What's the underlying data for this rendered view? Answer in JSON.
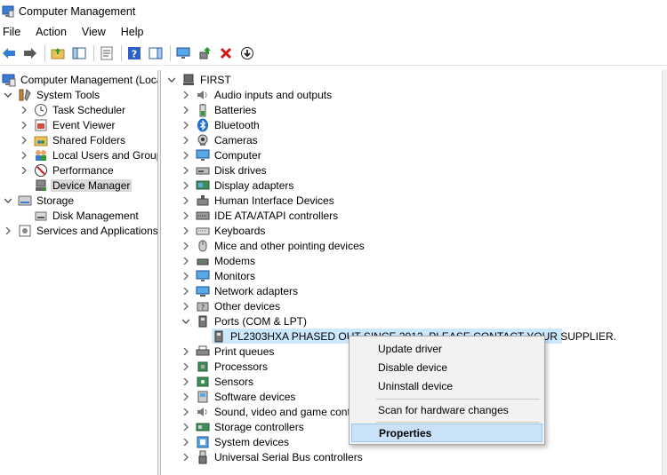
{
  "window": {
    "title": "Computer Management"
  },
  "menu": [
    "File",
    "Action",
    "View",
    "Help"
  ],
  "toolbar": {
    "buttons": [
      "back-icon",
      "forward-icon",
      "up-folder-icon",
      "show-hide-tree-icon",
      "properties-icon",
      "help-icon",
      "action-pane-icon",
      "monitor-icon",
      "update-driver-icon",
      "uninstall-icon",
      "download-icon"
    ]
  },
  "left_tree": {
    "root": "Computer Management (Local",
    "system_tools": "System Tools",
    "task_scheduler": "Task Scheduler",
    "event_viewer": "Event Viewer",
    "shared_folders": "Shared Folders",
    "local_users": "Local Users and Groups",
    "performance": "Performance",
    "device_manager": "Device Manager",
    "storage": "Storage",
    "disk_management": "Disk Management",
    "services": "Services and Applications"
  },
  "device_tree": {
    "root": "FIRST",
    "categories": [
      "Audio inputs and outputs",
      "Batteries",
      "Bluetooth",
      "Cameras",
      "Computer",
      "Disk drives",
      "Display adapters",
      "Human Interface Devices",
      "IDE ATA/ATAPI controllers",
      "Keyboards",
      "Mice and other pointing devices",
      "Modems",
      "Monitors",
      "Network adapters",
      "Other devices",
      "Ports (COM & LPT)"
    ],
    "port_device": "PL2303HXA PHASED OUT SINCE 2012. PLEASE CONTACT YOUR SUPPLIER.",
    "categories_after": [
      "Print queues",
      "Processors",
      "Sensors",
      "Software devices",
      "Sound, video and game controllers",
      "Storage controllers",
      "System devices",
      "Universal Serial Bus controllers"
    ]
  },
  "context_menu": {
    "update_driver": "Update driver",
    "disable_device": "Disable device",
    "uninstall_device": "Uninstall device",
    "scan_hardware": "Scan for hardware changes",
    "properties": "Properties"
  },
  "colors": {
    "selection": "#cce8ff",
    "menu_active": "#c9e2f8",
    "accent_green": "#2e9b2e",
    "accent_red": "#d11919",
    "accent_blue": "#1e6fd0"
  }
}
